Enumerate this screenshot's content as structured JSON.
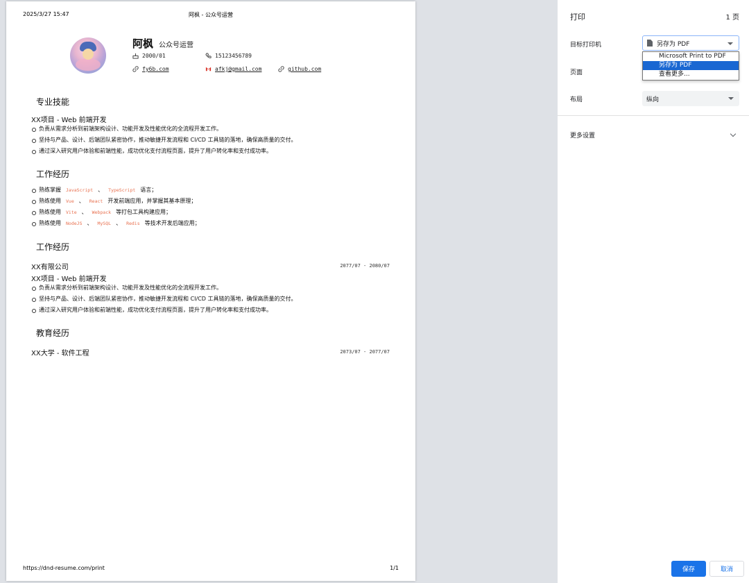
{
  "preview": {
    "header_datetime": "2025/3/27 15:47",
    "header_title": "阿枫 - 公众号运营",
    "footer_url": "https://dnd-resume.com/print",
    "footer_page": "1/1",
    "resume": {
      "name": "阿枫",
      "role": "公众号运营",
      "birth": "2000/01",
      "phone": "15123456789",
      "site": "fy6b.com",
      "email": "afkj@gmail.com",
      "github": "github.com",
      "skills": {
        "title": "专业技能",
        "project": "XX项目 - Web 前端开发",
        "bullets": [
          "负责从需求分析到前端架构设计、功能开发及性能优化的全流程开发工作。",
          "坚持与产品、设计、后端团队紧密协作，推动敏捷开发流程和 CI/CD 工具链的落地，确保高质量的交付。",
          "通过深入研究用户体验和前端性能，成功优化支付流程页面，提升了用户转化率和支付成功率。"
        ]
      },
      "work1": {
        "title": "工作经历",
        "items": [
          {
            "pre": "熟练掌握",
            "codes": [
              "JavaScript",
              "TypeScript"
            ],
            "sep": "、",
            "post": "语言；"
          },
          {
            "pre": "熟练使用",
            "codes": [
              "Vue",
              "React"
            ],
            "sep": "、",
            "post": "开发前端应用，并掌握其基本原理；"
          },
          {
            "pre": "熟练使用",
            "codes": [
              "Vite",
              "Webpack"
            ],
            "sep": "、",
            "post": "等打包工具构建应用；"
          },
          {
            "pre": "熟练使用",
            "codes": [
              "NodeJS",
              "MySQL",
              "Redis"
            ],
            "sep": "、",
            "post": "等技术开发后端应用；"
          }
        ]
      },
      "work2": {
        "title": "工作经历",
        "company": "XX有限公司",
        "date": "2077/07 - 2080/07",
        "project": "XX项目 - Web 前端开发",
        "bullets": [
          "负责从需求分析到前端架构设计、功能开发及性能优化的全流程开发工作。",
          "坚持与产品、设计、后端团队紧密协作，推动敏捷开发流程和 CI/CD 工具链的落地，确保高质量的交付。",
          "通过深入研究用户体验和前端性能，成功优化支付流程页面，提升了用户转化率和支付成功率。"
        ]
      },
      "education": {
        "title": "教育经历",
        "school": "XX大学 - 软件工程",
        "date": "2073/07 - 2077/07"
      }
    }
  },
  "panel": {
    "title": "打印",
    "page_count": "1 页",
    "destination_label": "目标打印机",
    "destination_value": "另存为 PDF",
    "destination_options": [
      "Microsoft Print to PDF",
      "另存为 PDF",
      "查看更多..."
    ],
    "pages_label": "页面",
    "layout_label": "布局",
    "layout_value": "纵向",
    "more_settings": "更多设置",
    "save": "保存",
    "cancel": "取消"
  }
}
